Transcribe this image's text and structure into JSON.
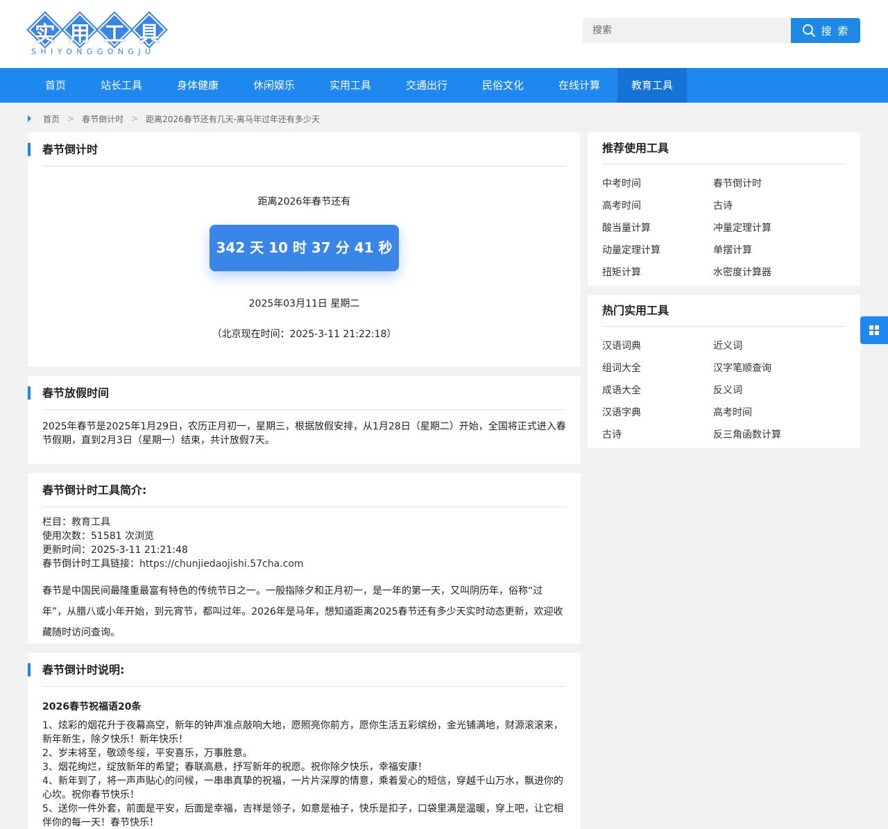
{
  "logo": {
    "chars": [
      "实",
      "用",
      "工",
      "具"
    ],
    "pinyin": "SHIYONGGONGJU",
    "colors": {
      "brand": "#3a86e8"
    }
  },
  "search": {
    "placeholder": "搜索",
    "button_label": "搜 索"
  },
  "nav": {
    "items": [
      "首页",
      "站长工具",
      "身体健康",
      "休闲娱乐",
      "实用工具",
      "交通出行",
      "民俗文化",
      "在线计算",
      "教育工具"
    ],
    "active": "教育工具",
    "color": "#1e88f0"
  },
  "breadcrumb": {
    "home": "首页",
    "section": "春节倒计时",
    "current": "距离2026春节还有几天-离马年过年还有多少天",
    "separator": ">"
  },
  "countdown": {
    "title": "春节倒计时",
    "label": "距离2026年春节还有",
    "value": "342 天 10 时 37 分 41 秒",
    "date": "2025年03月11日  星期二",
    "now": "（北京现在时间：2025-3-11 21:22:18）"
  },
  "holiday": {
    "title": "春节放假时间",
    "text": "2025年春节是2025年1月29日，农历正月初一，星期三，根据放假安排，从1月28日（星期二）开始，全国将正式进入春节假期，直到2月3日（星期一）结束，共计放假7天。"
  },
  "intro": {
    "title": "春节倒计时工具简介:",
    "category_label": "栏目：",
    "category": "教育工具",
    "usage_label": "使用次数：",
    "usage": "51581 次浏览",
    "updated_label": "更新时间：",
    "updated": "2025-3-11 21:21:48",
    "link_label": "春节倒计时工具链接：",
    "link": "https://chunjiedaojishi.57cha.com",
    "text": "春节是中国民间最隆重最富有特色的传统节日之一。一般指除夕和正月初一，是一年的第一天，又叫阴历年，俗称“过年”，从腊八或小年开始，到元宵节，都叫过年。2026年是马年，想知道距离2025春节还有多少天实时动态更新，欢迎收藏随时访问查询。"
  },
  "notes": {
    "title": "春节倒计时说明:",
    "bless_title": "2026春节祝福语20条",
    "lines": [
      "1、炫彩的烟花升于夜幕高空，新年的钟声准点敲响大地，愿照亮你前方，愿你生活五彩缤纷，金光铺满地，财源滚滚来，新年新生，除夕快乐！新年快乐！",
      "2、岁末将至，敬颂冬绥，平安喜乐，万事胜意。",
      "3、烟花绚烂，绽放新年的希望；春联高悬，抒写新年的祝愿。祝你除夕快乐，幸福安康！",
      "4、新年到了，将一声声贴心的问候，一串串真挚的祝福，一片片深厚的情意，乘着爱心的短信，穿越千山万水，飘进你的心坎。祝你春节快乐！",
      "5、送你一件外套，前面是平安，后面是幸福，吉祥是领子，如意是袖子，快乐是扣子，口袋里满是温暖，穿上吧，让它相伴你的每一天！春节快乐！"
    ]
  },
  "recommended": {
    "title": "推荐使用工具",
    "items": [
      "中考时间",
      "春节倒计时",
      "高考时间",
      "古诗",
      "酸当量计算",
      "冲量定理计算",
      "动量定理计算",
      "单摆计算",
      "扭矩计算",
      "水密度计算器"
    ]
  },
  "hot": {
    "title": "热门实用工具",
    "items": [
      "汉语词典",
      "近义词",
      "组词大全",
      "汉字笔顺查询",
      "成语大全",
      "反义词",
      "汉语字典",
      "高考时间",
      "古诗",
      "反三角函数计算"
    ]
  },
  "float_button": {
    "icon": "grid-icon"
  }
}
